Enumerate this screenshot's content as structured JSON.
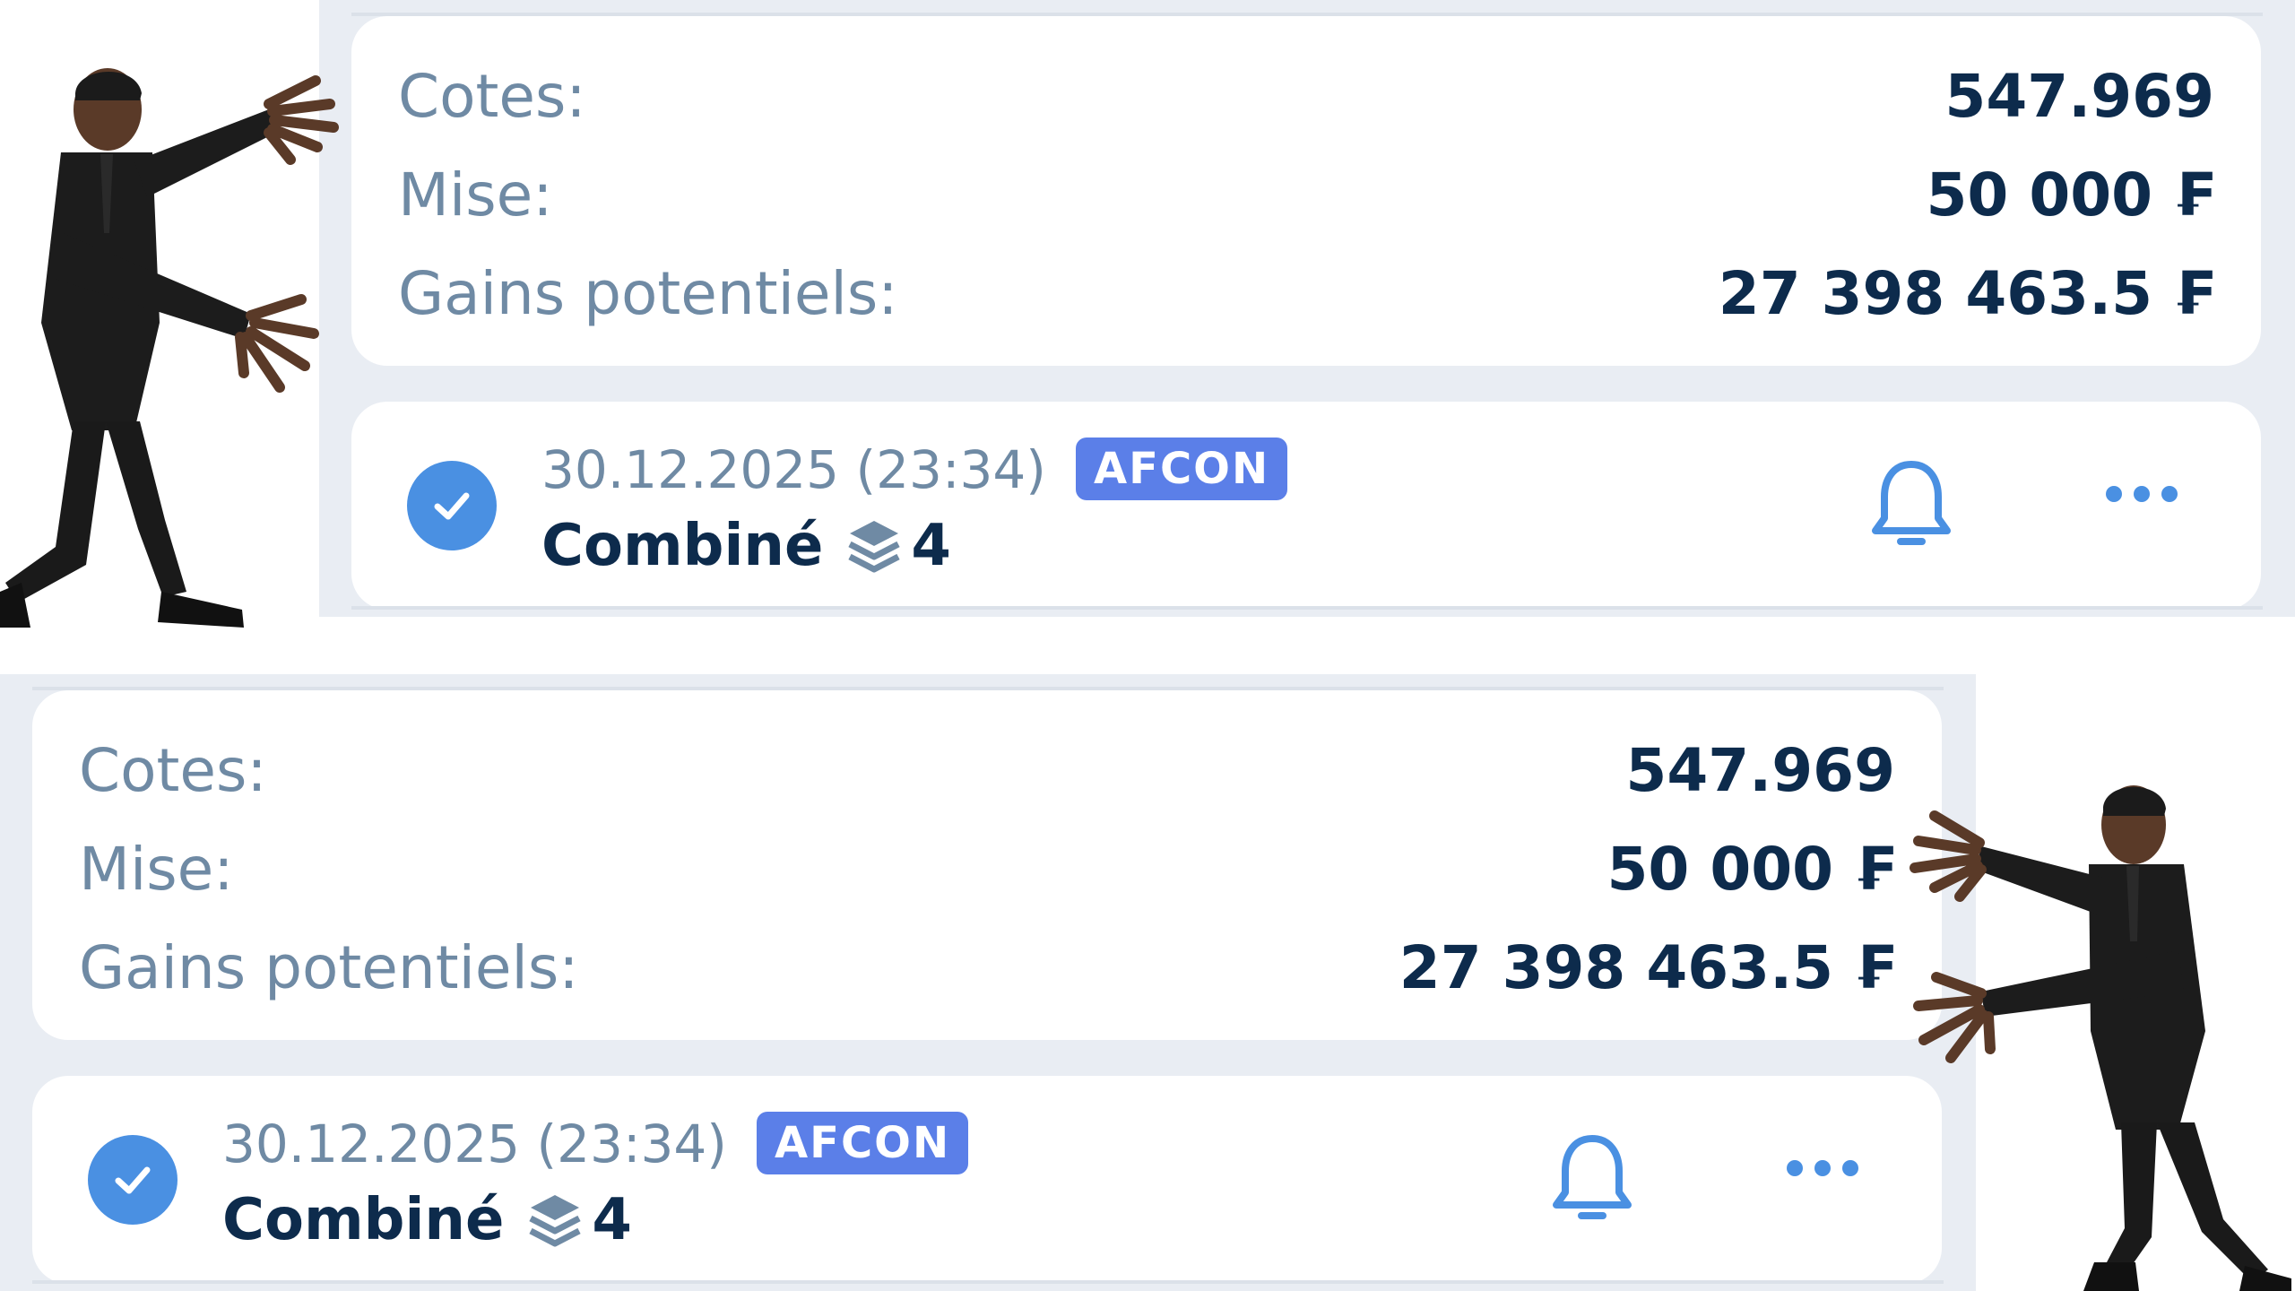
{
  "panels": [
    {
      "summary": {
        "odds_label": "Cotes:",
        "odds_value": "547.969",
        "stake_label": "Mise:",
        "stake_value": "50 000 ₣",
        "winnings_label": "Gains potentiels:",
        "winnings_value": "27 398 463.5 ₣"
      },
      "bet": {
        "status": "check-circle-icon",
        "date": "30.12.2025 (23:34)",
        "tag": "AFCON",
        "type": "Combiné",
        "count": "4",
        "bell": "bell-icon",
        "more": "more-icon"
      }
    },
    {
      "summary": {
        "odds_label": "Cotes:",
        "odds_value": "547.969",
        "stake_label": "Mise:",
        "stake_value": "50 000 ₣",
        "winnings_label": "Gains potentiels:",
        "winnings_value": "27 398 463.5 ₣"
      },
      "bet": {
        "status": "check-circle-icon",
        "date": "30.12.2025 (23:34)",
        "tag": "AFCON",
        "type": "Combiné",
        "count": "4",
        "bell": "bell-icon",
        "more": "more-icon"
      }
    }
  ],
  "colors": {
    "background": "#e9edf3",
    "card": "#ffffff",
    "label": "#6f8aa4",
    "value": "#0d2b4c",
    "accent": "#4a90e2",
    "tag": "#5b7fe8"
  },
  "overlay": {
    "figure_left": "man-in-suit-gesturing-right",
    "figure_right": "man-in-suit-gesturing-left"
  }
}
